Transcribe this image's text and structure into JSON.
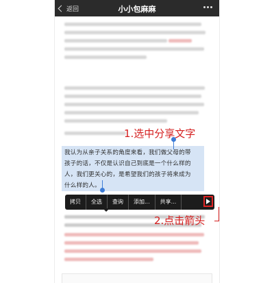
{
  "navbar": {
    "back_label": "返回",
    "title": "小小包麻麻"
  },
  "selection": {
    "lines": [
      "我认为从亲子关系的角度来看，我们做父母的带",
      "孩子的话，不仅是认识自己到底是一个什么样的",
      "人，我们更关心的，是希望我们的孩子将来成为",
      "什么样的人。"
    ]
  },
  "context_menu": {
    "items": [
      "拷贝",
      "全选",
      "查询",
      "添加...",
      "共享..."
    ],
    "more_icon": "play-arrow"
  },
  "annotations": {
    "step1": "1.选中分享文字",
    "step2": "2.点击箭头",
    "color": "#d41d1d"
  }
}
